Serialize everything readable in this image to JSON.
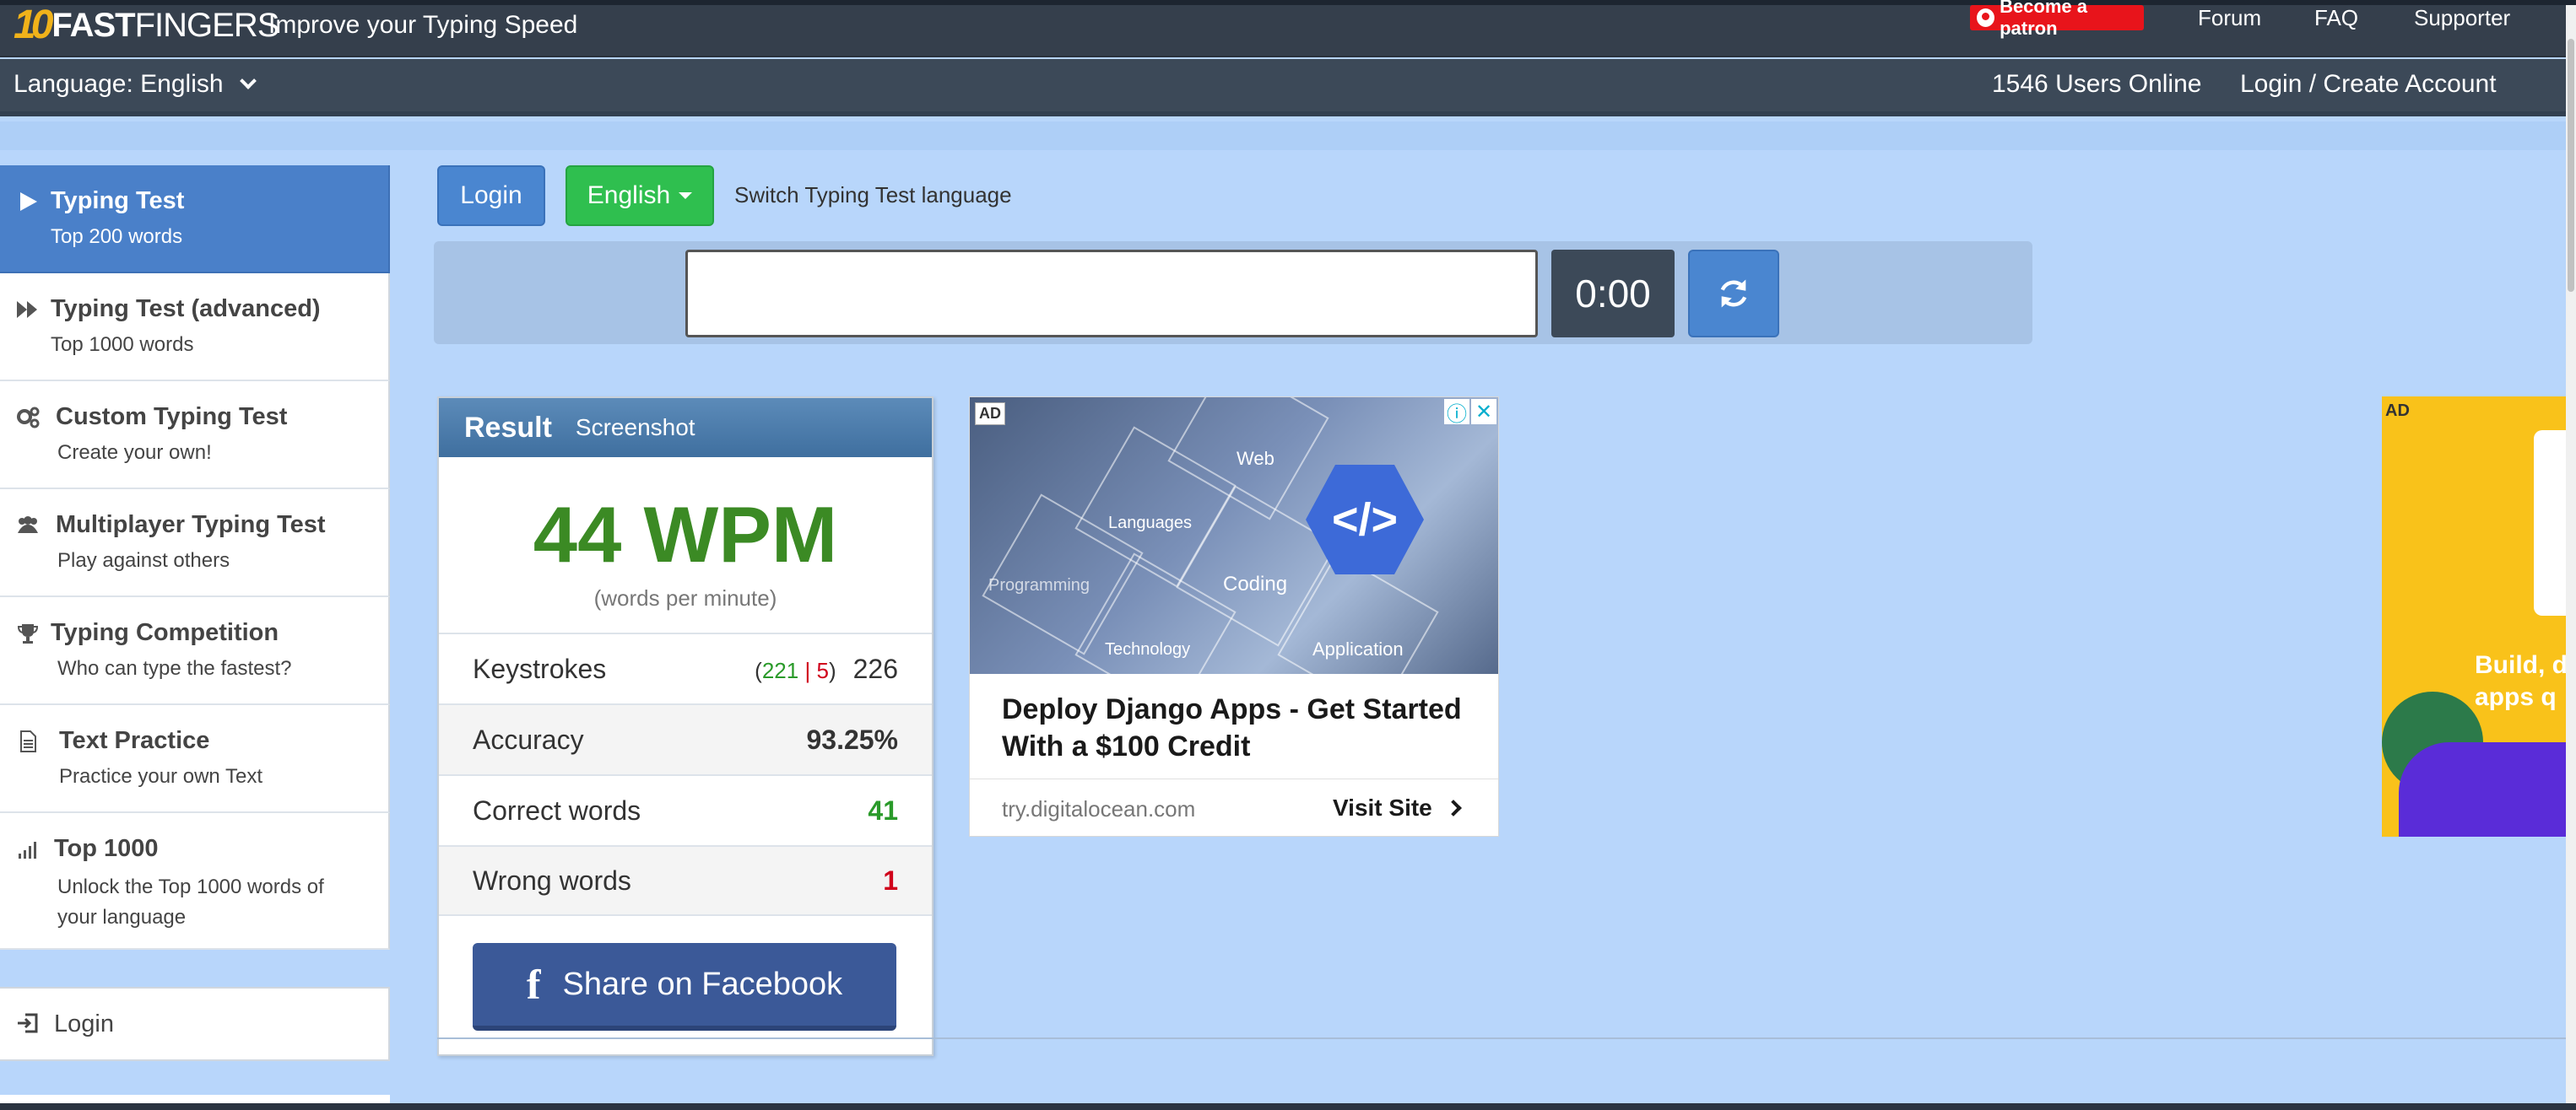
{
  "header": {
    "logo_num": "10",
    "logo_fast": "FAST",
    "logo_fingers": "FINGERS",
    "tagline": "Improve your Typing Speed",
    "patron": "Become a patron",
    "nav": [
      "Forum",
      "FAQ",
      "Supporter"
    ]
  },
  "subnav": {
    "language": "Language: English",
    "users_online": "1546 Users Online",
    "login_create": "Login / Create Account"
  },
  "sidebar": {
    "items": [
      {
        "title": "Typing Test",
        "sub": "Top 200 words",
        "icon": "play-icon"
      },
      {
        "title": "Typing Test (advanced)",
        "sub": "Top 1000 words",
        "icon": "fast-forward-icon"
      },
      {
        "title": "Custom Typing Test",
        "sub": "Create your own!",
        "icon": "gears-icon"
      },
      {
        "title": "Multiplayer Typing Test",
        "sub": "Play against others",
        "icon": "users-icon"
      },
      {
        "title": "Typing Competition",
        "sub": "Who can type the fastest?",
        "icon": "trophy-icon"
      },
      {
        "title": "Text Practice",
        "sub": "Practice your own Text",
        "icon": "document-icon"
      },
      {
        "title": "Top 1000",
        "sub": "Unlock the Top 1000 words of your language",
        "icon": "signal-icon"
      }
    ],
    "login": "Login"
  },
  "toolbar": {
    "login": "Login",
    "language": "English",
    "switch_label": "Switch Typing Test language"
  },
  "typing": {
    "input_value": "",
    "timer": "0:00"
  },
  "result": {
    "title": "Result",
    "screenshot": "Screenshot",
    "wpm": "44 WPM",
    "wpm_sub": "(words per minute)",
    "keystrokes_label": "Keystrokes",
    "keystrokes_correct": "221",
    "keystrokes_sep": "|",
    "keystrokes_wrong": "5",
    "keystrokes_total": "226",
    "accuracy_label": "Accuracy",
    "accuracy": "93.25%",
    "correct_label": "Correct words",
    "correct": "41",
    "wrong_label": "Wrong words",
    "wrong": "1",
    "share": "Share on Facebook"
  },
  "ad": {
    "tag": "AD",
    "hex_labels": [
      "Web",
      "Languages",
      "Coding",
      "Programming",
      "Technology",
      "Application"
    ],
    "code_symbol": "</>",
    "headline": "Deploy Django Apps - Get Started With a $100 Credit",
    "domain": "try.digitalocean.com",
    "visit": "Visit Site"
  },
  "ad2": {
    "tag": "AD",
    "text_line1": "Build, d",
    "text_line2": "apps q"
  }
}
